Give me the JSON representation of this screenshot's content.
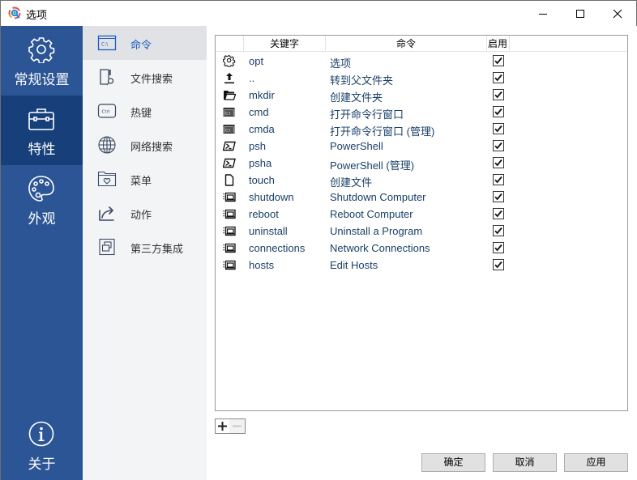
{
  "window": {
    "title": "选项",
    "minimize_label": "minimize",
    "maximize_label": "maximize",
    "close_label": "close"
  },
  "categories": [
    {
      "label": "常规设置",
      "icon": "gear-icon",
      "active": false
    },
    {
      "label": "特性",
      "icon": "toolbox-icon",
      "active": true
    },
    {
      "label": "外观",
      "icon": "palette-icon",
      "active": false
    },
    {
      "label": "关于",
      "icon": "info-icon",
      "active": false
    }
  ],
  "subnav": [
    {
      "label": "命令",
      "icon": "command-prompt-icon",
      "active": true
    },
    {
      "label": "文件搜索",
      "icon": "file-search-icon",
      "active": false
    },
    {
      "label": "热键",
      "icon": "ctrl-key-icon",
      "active": false
    },
    {
      "label": "网络搜索",
      "icon": "globe-icon",
      "active": false
    },
    {
      "label": "菜单",
      "icon": "menu-folder-icon",
      "active": false
    },
    {
      "label": "动作",
      "icon": "share-action-icon",
      "active": false
    },
    {
      "label": "第三方集成",
      "icon": "integration-icon",
      "active": false
    }
  ],
  "ctrl_icon_text": "Ctrl",
  "cmd_icon_text": "C:\\",
  "table": {
    "headers": {
      "icon": "",
      "keyword": "关键字",
      "command": "命令",
      "enabled": "启用"
    },
    "rows": [
      {
        "icon": "gear-icon",
        "keyword": "opt",
        "command": "选项",
        "enabled": true
      },
      {
        "icon": "upload-arrow-icon",
        "keyword": "..",
        "command": "转到父文件夹",
        "enabled": true
      },
      {
        "icon": "folder-open-icon",
        "keyword": "mkdir",
        "command": "创建文件夹",
        "enabled": true
      },
      {
        "icon": "cmd-window-icon",
        "keyword": "cmd",
        "command": "打开命令行窗口",
        "enabled": true
      },
      {
        "icon": "cmd-window-icon",
        "keyword": "cmda",
        "command": "打开命令行窗口 (管理)",
        "enabled": true
      },
      {
        "icon": "powershell-icon",
        "keyword": "psh",
        "command": "PowerShell",
        "enabled": true
      },
      {
        "icon": "powershell-icon",
        "keyword": "psha",
        "command": "PowerShell (管理)",
        "enabled": true
      },
      {
        "icon": "file-icon",
        "keyword": "touch",
        "command": "创建文件",
        "enabled": true
      },
      {
        "icon": "control-panel-icon",
        "keyword": "shutdown",
        "command": "Shutdown Computer",
        "enabled": true
      },
      {
        "icon": "control-panel-icon",
        "keyword": "reboot",
        "command": "Reboot Computer",
        "enabled": true
      },
      {
        "icon": "control-panel-icon",
        "keyword": "uninstall",
        "command": "Uninstall a Program",
        "enabled": true
      },
      {
        "icon": "control-panel-icon",
        "keyword": "connections",
        "command": "Network Connections",
        "enabled": true
      },
      {
        "icon": "control-panel-icon",
        "keyword": "hosts",
        "command": "Edit Hosts",
        "enabled": true
      }
    ]
  },
  "table_actions": {
    "add": "+",
    "remove": "−"
  },
  "footer": {
    "ok": "确定",
    "cancel": "取消",
    "apply": "应用"
  },
  "colors": {
    "category_bg": "#2b5595",
    "category_active_bg": "#17407a",
    "subnav_bg": "#f3f4f6",
    "subnav_active_bg": "#e0e2e6",
    "accent": "#1f5fbf"
  }
}
